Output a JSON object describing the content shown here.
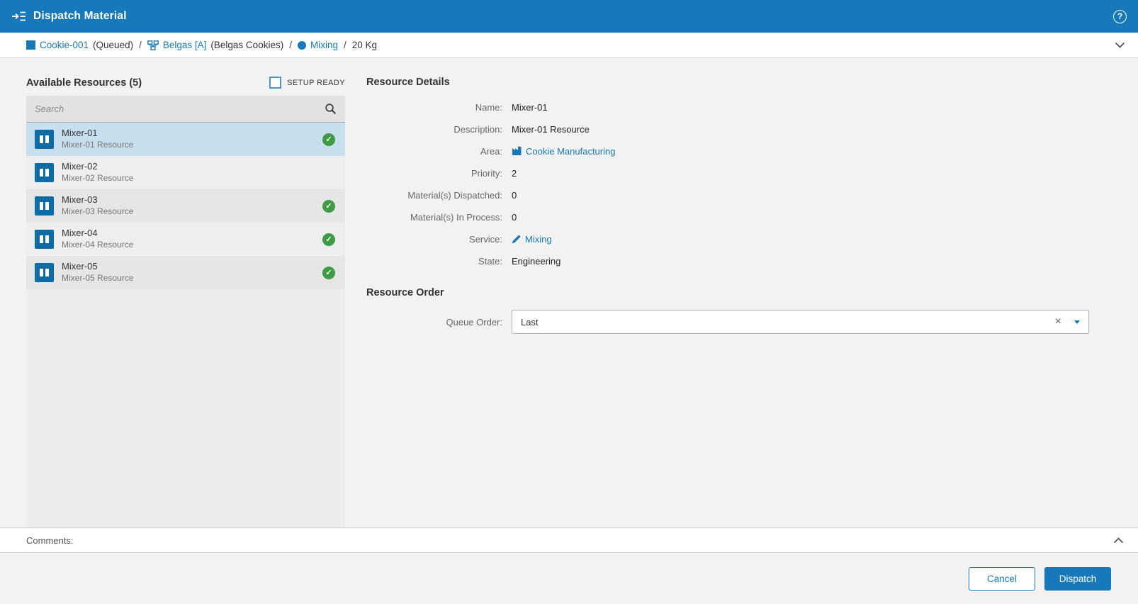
{
  "colors": {
    "accent": "#1779ba",
    "ready_green": "#3d9b43",
    "selected_row": "#c7dfef"
  },
  "topbar": {
    "title": "Dispatch Material",
    "help_icon_label": "?"
  },
  "breadcrumb": {
    "items": [
      {
        "icon": "material-square-icon",
        "link": "Cookie-001",
        "suffix": "(Queued)"
      },
      {
        "icon": "order-workflow-icon",
        "link": "Belgas [A]",
        "suffix": "(Belgas Cookies)"
      },
      {
        "icon": "operation-circle-icon",
        "link": "Mixing",
        "suffix": ""
      },
      {
        "icon": "",
        "link": "",
        "suffix": "20 Kg"
      }
    ]
  },
  "resources": {
    "heading": "Available Resources (5)",
    "setup_ready_label": "SETUP READY",
    "setup_ready_checked": false,
    "search_placeholder": "Search",
    "items": [
      {
        "name": "Mixer-01",
        "description": "Mixer-01 Resource",
        "selected": true,
        "ready": true
      },
      {
        "name": "Mixer-02",
        "description": "Mixer-02 Resource",
        "selected": false,
        "ready": false
      },
      {
        "name": "Mixer-03",
        "description": "Mixer-03 Resource",
        "selected": false,
        "ready": true
      },
      {
        "name": "Mixer-04",
        "description": "Mixer-04 Resource",
        "selected": false,
        "ready": true
      },
      {
        "name": "Mixer-05",
        "description": "Mixer-05 Resource",
        "selected": false,
        "ready": true
      }
    ]
  },
  "details": {
    "heading": "Resource Details",
    "fields": [
      {
        "label": "Name:",
        "value": "Mixer-01",
        "type": "text"
      },
      {
        "label": "Description:",
        "value": "Mixer-01 Resource",
        "type": "text"
      },
      {
        "label": "Area:",
        "value": "Cookie Manufacturing",
        "type": "link",
        "icon": "area-icon"
      },
      {
        "label": "Priority:",
        "value": "2",
        "type": "text"
      },
      {
        "label": "Material(s) Dispatched:",
        "value": "0",
        "type": "text"
      },
      {
        "label": "Material(s) In Process:",
        "value": "0",
        "type": "text"
      },
      {
        "label": "Service:",
        "value": "Mixing",
        "type": "link",
        "icon": "service-icon"
      },
      {
        "label": "State:",
        "value": "Engineering",
        "type": "text"
      }
    ]
  },
  "resource_order": {
    "heading": "Resource Order",
    "queue_order_label": "Queue Order:",
    "queue_order_value": "Last",
    "clear_icon_label": "×"
  },
  "comments": {
    "label": "Comments:"
  },
  "footer": {
    "cancel_label": "Cancel",
    "dispatch_label": "Dispatch"
  }
}
